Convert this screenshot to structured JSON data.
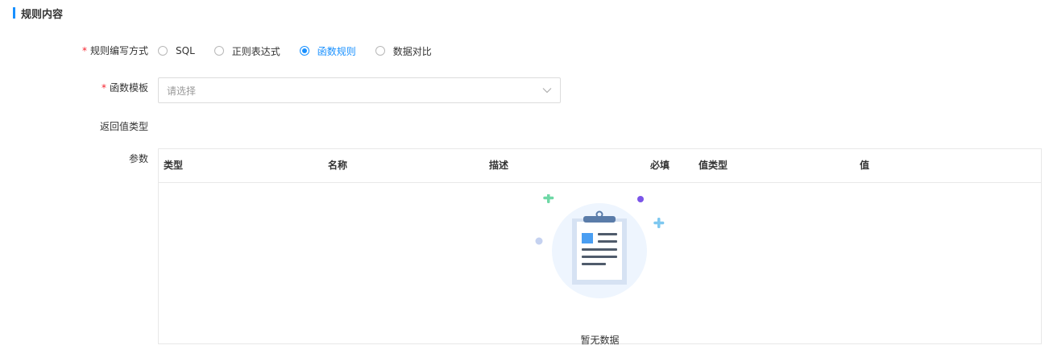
{
  "section": {
    "title": "规则内容"
  },
  "form": {
    "rule_mode": {
      "label": "规则编写方式",
      "required": "*",
      "options": [
        {
          "label": "SQL",
          "checked": false
        },
        {
          "label": "正则表达式",
          "checked": false
        },
        {
          "label": "函数规则",
          "checked": true
        },
        {
          "label": "数据对比",
          "checked": false
        }
      ]
    },
    "function_template": {
      "label": "函数模板",
      "required": "*",
      "placeholder": "请选择"
    },
    "return_type": {
      "label": "返回值类型"
    },
    "params": {
      "label": "参数"
    }
  },
  "table": {
    "columns": [
      "类型",
      "名称",
      "描述",
      "必填",
      "值类型",
      "值"
    ],
    "rows": [],
    "empty_text": "暂无数据"
  },
  "colors": {
    "accent": "#1890ff",
    "required": "#f5222d"
  },
  "icons": {
    "empty": "empty-clipboard-icon",
    "select": "chevron-down-icon"
  }
}
